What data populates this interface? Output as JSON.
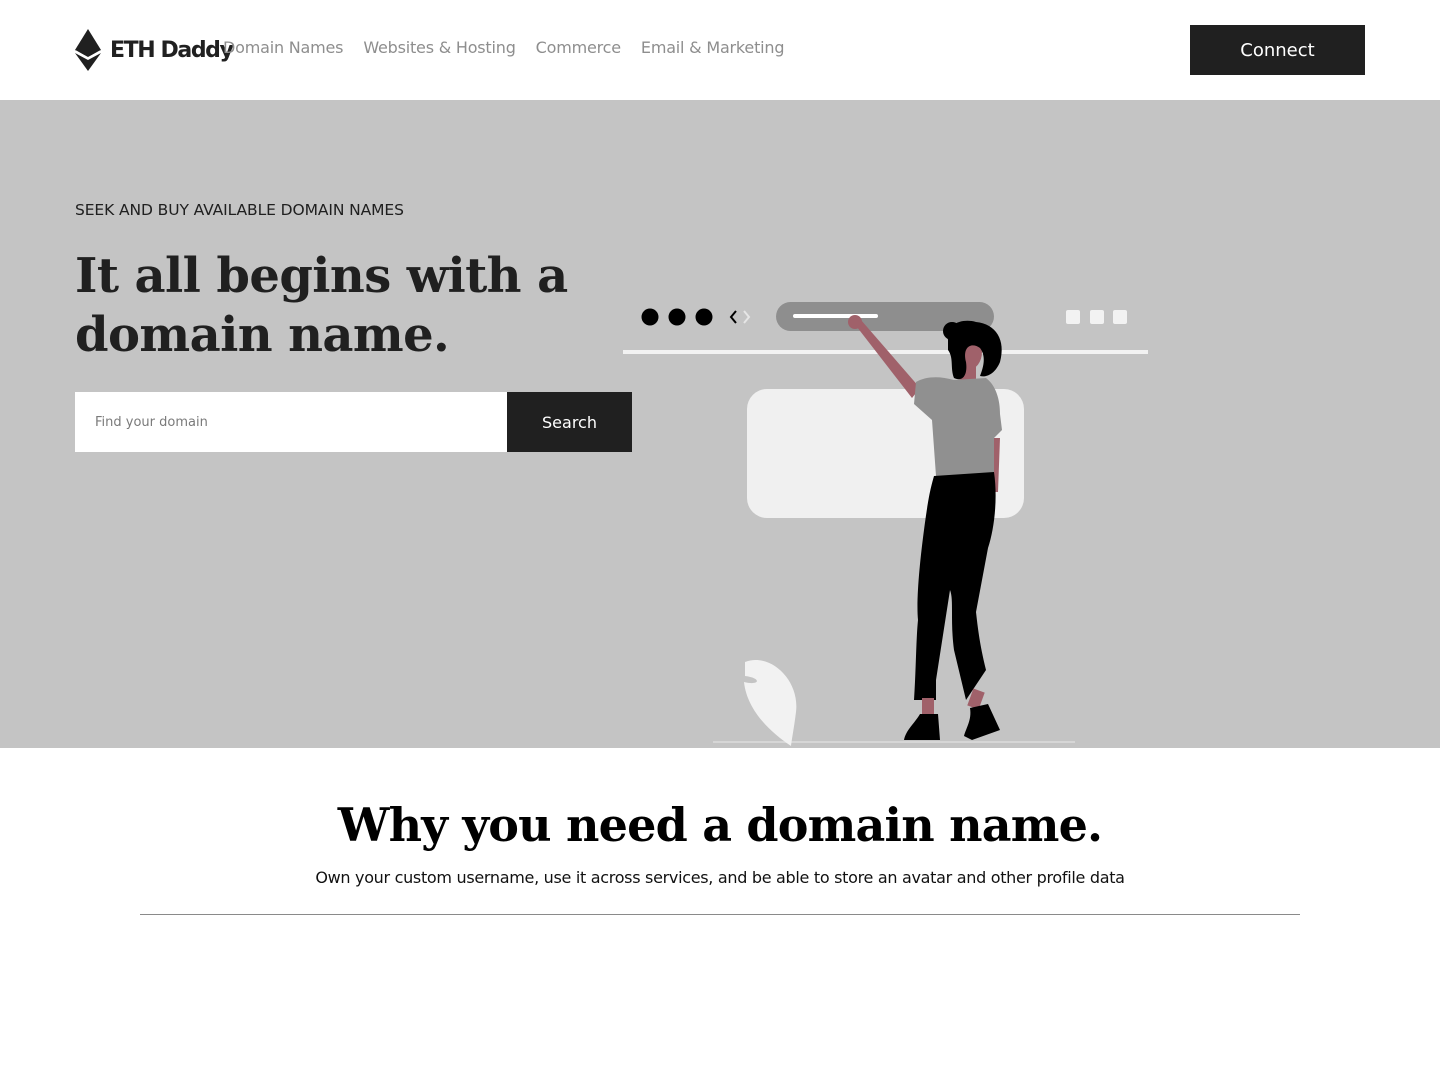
{
  "brand": {
    "name": "ETH Daddy",
    "logo_icon": "ethereum-diamond-icon"
  },
  "nav": {
    "links": [
      {
        "label": "Domain Names"
      },
      {
        "label": "Websites & Hosting"
      },
      {
        "label": "Commerce"
      },
      {
        "label": "Email & Marketing"
      }
    ],
    "connect_label": "Connect"
  },
  "hero": {
    "eyebrow": "SEEK AND BUY AVAILABLE DOMAIN NAMES",
    "title": "It all begins with a domain name.",
    "search": {
      "placeholder": "Find your domain",
      "value": "",
      "button_label": "Search"
    },
    "illustration": "woman-reaching-browser-bar-illustration"
  },
  "why": {
    "title": "Why you need a domain name.",
    "subtitle": "Own your custom username, use it across services, and be able to store an avatar and other profile data"
  },
  "colors": {
    "hero_background": "#c4c4c4",
    "dark": "#202020",
    "nav_link": "#8e8e8e",
    "accent_skin": "#a0616a"
  }
}
